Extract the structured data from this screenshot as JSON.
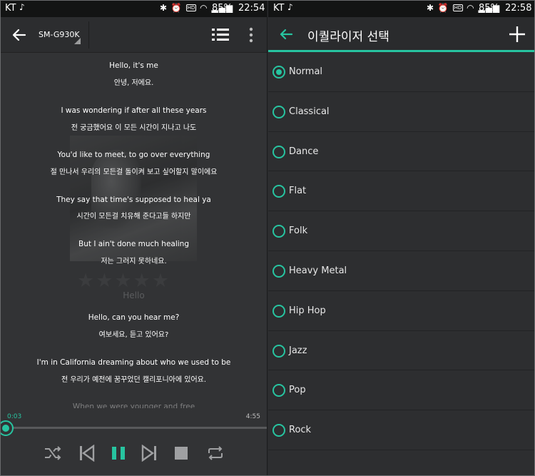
{
  "left_screen": {
    "status": {
      "carrier": "KT",
      "battery": "85%",
      "time": "22:54"
    },
    "toolbar": {
      "device_name": "SM-G930K"
    },
    "lyrics": [
      "Hello, it's me",
      "안녕, 저에요.",
      "I was wondering if after all these years",
      "전 궁금했어요 이 모든 시간이 지나고 나도",
      "You'd like to meet, to go over everything",
      "절 만나서 우리의 모든걸 돌이켜 보고 싶어할지 말이에요",
      "They say that time's supposed to heal ya",
      "시간이 모든걸 치유해 준다고들 하지만",
      "But I ain't done much healing",
      "저는 그러지 못하네요.",
      "Hello, can you hear me?",
      "여보세요, 듣고 있어요?",
      "I'm in California dreaming about who we used to be",
      "전 우리가 예전에 꿈꾸었던 캘리포니아에 있어요.",
      "When we were younger and free"
    ],
    "background_track_title": "Hello",
    "background_rating": "★★★★★",
    "playback": {
      "elapsed": "0:03",
      "duration": "4:55",
      "progress": 0.01
    }
  },
  "right_screen": {
    "status": {
      "carrier": "KT",
      "battery": "85%",
      "time": "22:58"
    },
    "title": "이퀄라이저 선택",
    "presets": [
      "Normal",
      "Classical",
      "Dance",
      "Flat",
      "Folk",
      "Heavy Metal",
      "Hip Hop",
      "Jazz",
      "Pop",
      "Rock"
    ],
    "selected_preset": "Normal"
  },
  "colors": {
    "accent": "#27c4a0",
    "background": "#323335",
    "status_bar": "#131414"
  }
}
